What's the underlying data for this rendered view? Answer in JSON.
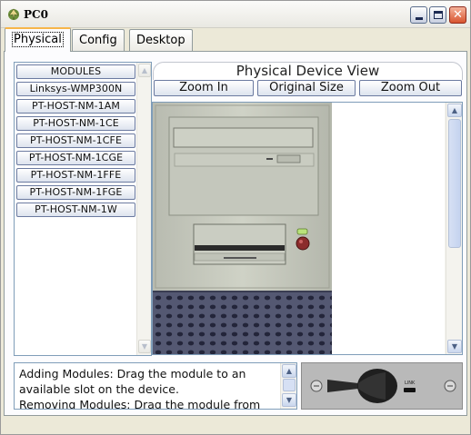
{
  "window": {
    "title": "PC0",
    "minimize_icon": "minimize-icon",
    "maximize_icon": "maximize-icon",
    "close_icon": "close-icon"
  },
  "tabs": [
    {
      "label": "Physical",
      "active": true
    },
    {
      "label": "Config",
      "active": false
    },
    {
      "label": "Desktop",
      "active": false
    }
  ],
  "modules": {
    "header": "MODULES",
    "items": [
      "Linksys-WMP300N",
      "PT-HOST-NM-1AM",
      "PT-HOST-NM-1CE",
      "PT-HOST-NM-1CFE",
      "PT-HOST-NM-1CGE",
      "PT-HOST-NM-1FFE",
      "PT-HOST-NM-1FGE",
      "PT-HOST-NM-1W"
    ]
  },
  "device_view": {
    "title": "Physical Device View",
    "zoom_in": "Zoom In",
    "original_size": "Original Size",
    "zoom_out": "Zoom Out"
  },
  "info": {
    "lines": [
      "Adding Modules: Drag the module to an",
      "available slot on the device.",
      "Removing Modules: Drag the module from"
    ]
  },
  "module_preview": {
    "link_label": "LINK"
  },
  "colors": {
    "title_active_tab_accent": "#f7b64a",
    "close_button": "#d8542f",
    "window_bg": "#ece9d8"
  }
}
